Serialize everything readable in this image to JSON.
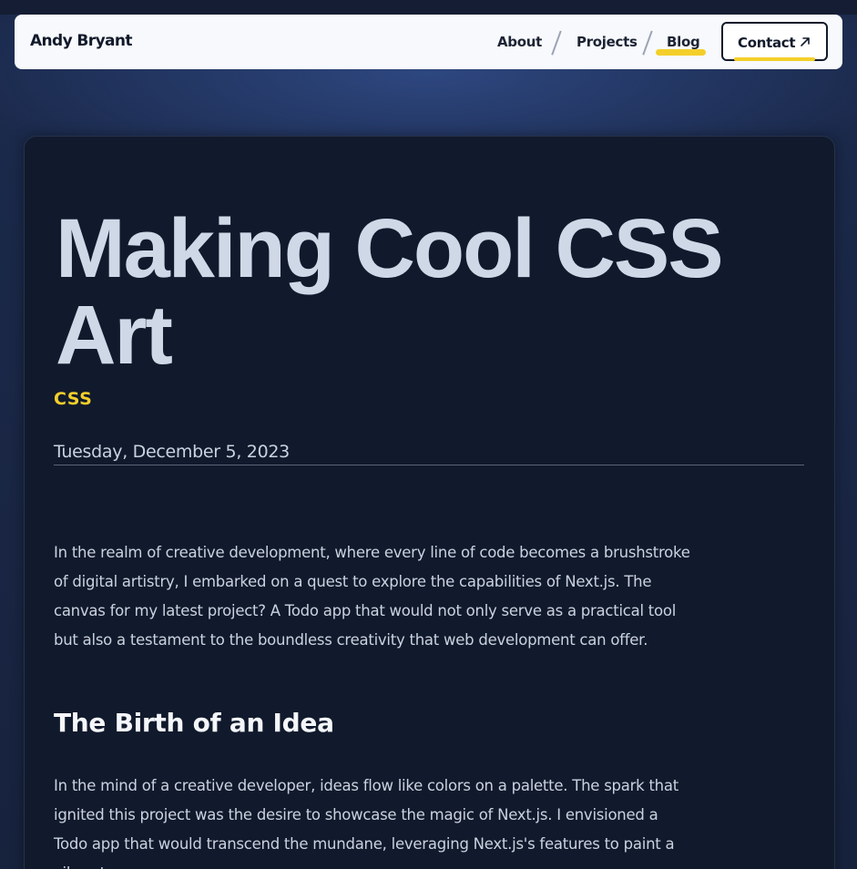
{
  "nav": {
    "brand": "Andy Bryant",
    "links": [
      {
        "label": "About"
      },
      {
        "label": "Projects"
      },
      {
        "label": "Blog",
        "active": true
      }
    ],
    "contact_label": "Contact",
    "contact_icon": "arrow-up-right-icon",
    "accent_color": "#f4cf2a"
  },
  "post": {
    "title": "Making Cool CSS Art",
    "tag": "CSS",
    "date": "Tuesday, December 5, 2023",
    "intro": "In the realm of creative development, where every line of code becomes a brushstroke of digital artistry, I embarked on a quest to explore the capabilities of Next.js. The canvas for my latest project? A Todo app that would not only serve as a practical tool but also a testament to the boundless creativity that web development can offer.",
    "section_heading": "The Birth of an Idea",
    "section_body": "In the mind of a creative developer, ideas flow like colors on a palette. The spark that ignited this project was the desire to showcase the magic of Next.js. I envisioned a Todo app that would transcend the mundane, leveraging Next.js's features to paint a vibrant"
  }
}
